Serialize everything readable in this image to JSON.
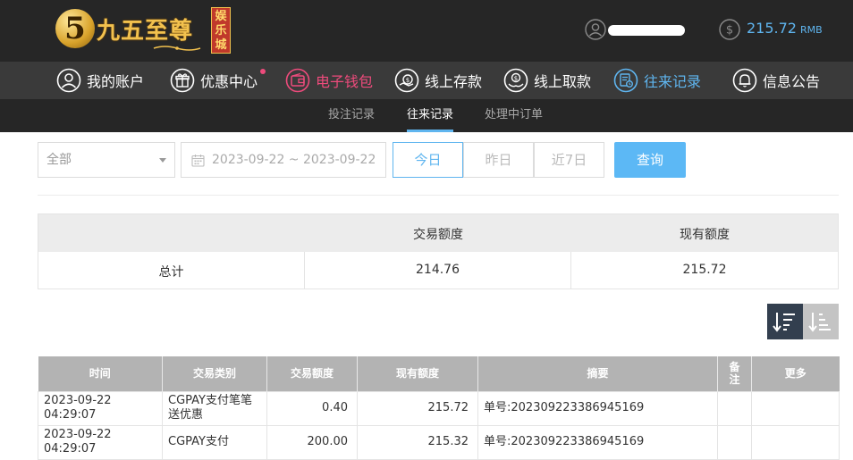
{
  "brand": {
    "logo_numeral": "5",
    "logo_text": "九五至尊",
    "logo_badge": "娱乐城",
    "gold": "#f2c14e"
  },
  "account": {
    "balance": "215.72",
    "unit": "RMB"
  },
  "nav": {
    "items": [
      {
        "label": "我的账户",
        "icon": "user-circle-icon"
      },
      {
        "label": "优惠中心",
        "icon": "gift-icon"
      },
      {
        "label": "电子钱包",
        "icon": "wallet-icon"
      },
      {
        "label": "线上存款",
        "icon": "deposit-icon"
      },
      {
        "label": "线上取款",
        "icon": "withdraw-icon"
      },
      {
        "label": "往来记录",
        "icon": "records-icon"
      },
      {
        "label": "信息公告",
        "icon": "bell-icon"
      }
    ],
    "accent_pink": "#ee4b7c",
    "accent_blue": "#5fb5ef"
  },
  "subnav": {
    "items": [
      "投注记录",
      "往来记录",
      "处理中订单"
    ],
    "active": "往来记录"
  },
  "filter": {
    "type_selected": "全部",
    "date_range": "2023-09-22 ~ 2023-09-22",
    "quick": [
      "今日",
      "昨日",
      "近7日"
    ],
    "quick_active": "今日",
    "query_label": "查询"
  },
  "summary": {
    "headers": [
      "交易额度",
      "现有额度"
    ],
    "row_label": "总计",
    "transaction_amount": "214.76",
    "current_balance": "215.72"
  },
  "records": {
    "headers": [
      "时间",
      "交易类别",
      "交易额度",
      "现有额度",
      "摘要",
      "备注",
      "更多"
    ],
    "rows": [
      {
        "time": "2023-09-22 04:29:07",
        "category": "CGPAY支付笔笔送优惠",
        "amount": "0.40",
        "balance": "215.72",
        "summary": "单号:20230922338694​5169",
        "note": "",
        "more": ""
      },
      {
        "time": "2023-09-22 04:29:07",
        "category": "CGPAY支付",
        "amount": "200.00",
        "balance": "215.32",
        "summary": "单号:20230922338694​5169",
        "note": "",
        "more": ""
      }
    ]
  }
}
